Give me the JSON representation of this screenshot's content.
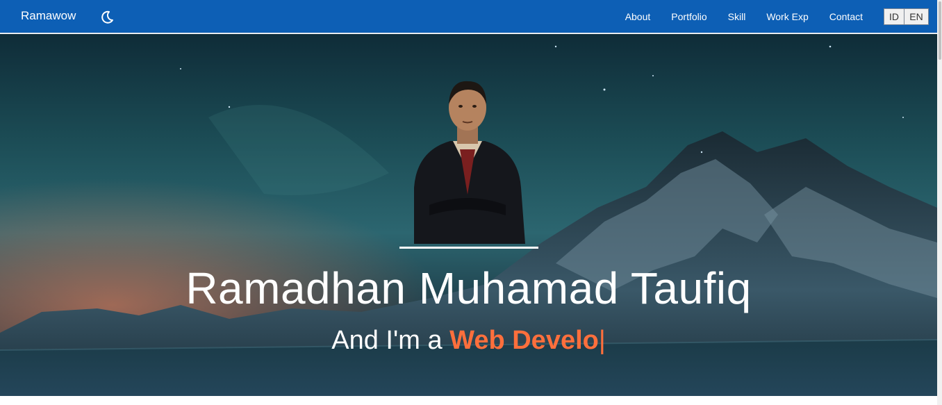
{
  "nav": {
    "brand": "Ramawow",
    "theme_icon": "moon-icon",
    "links": [
      "About",
      "Portfolio",
      "Skill",
      "Work Exp",
      "Contact"
    ],
    "languages": [
      "ID",
      "EN"
    ]
  },
  "hero": {
    "name": "Ramadhan Muhamad Taufiq",
    "tagline_prefix": "And I'm a ",
    "typed_text": "Web Develo",
    "cursor": "|"
  },
  "colors": {
    "navbar": "#0d5fb5",
    "accent": "#ff6f3c",
    "text": "#ffffff"
  }
}
